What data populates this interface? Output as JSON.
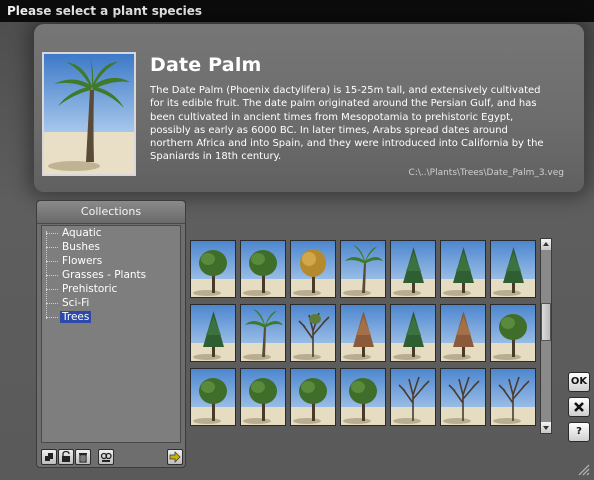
{
  "window": {
    "title": "Please select a plant species"
  },
  "plant": {
    "name": "Date Palm",
    "description": "The Date Palm (Phoenix dactylifera) is 15-25m tall, and extensively cultivated for its edible fruit. The date palm originated around the Persian Gulf, and has been cultivated in ancient times from Mesopotamia to prehistoric Egypt, possibly as early as 6000 BC. In later times, Arabs spread dates around northern Africa and into Spain, and they were introduced into California by the Spaniards in 18th century.",
    "file_path": "C:\\..\\Plants\\Trees\\Date_Palm_3.veg"
  },
  "collections": {
    "header": "Collections",
    "items": [
      "Aquatic",
      "Bushes",
      "Flowers",
      "Grasses - Plants",
      "Prehistoric",
      "Sci-Fi",
      "Trees"
    ],
    "selected": "Trees",
    "toolbar_icons": [
      "new-collection-icon",
      "lock-icon",
      "trash-icon",
      "rename-icon",
      "arrow-right-icon"
    ]
  },
  "thumbnails": {
    "count": 21,
    "types": [
      "broadleaf",
      "broadleaf",
      "autumn",
      "palm",
      "conifer",
      "conifer",
      "conifer",
      "conifer",
      "palm",
      "bare-tall",
      "conifer-red",
      "conifer",
      "conifer-red",
      "broadleaf",
      "broadleaf",
      "broadleaf",
      "broadleaf",
      "broadleaf",
      "bare",
      "bare",
      "bare"
    ]
  },
  "side_buttons": {
    "ok": "OK",
    "cancel_icon": "close-icon",
    "help": "?"
  },
  "colors": {
    "selection": "#2c49a8",
    "sky": "#6aa0d8",
    "sand": "#e6dcc2"
  }
}
